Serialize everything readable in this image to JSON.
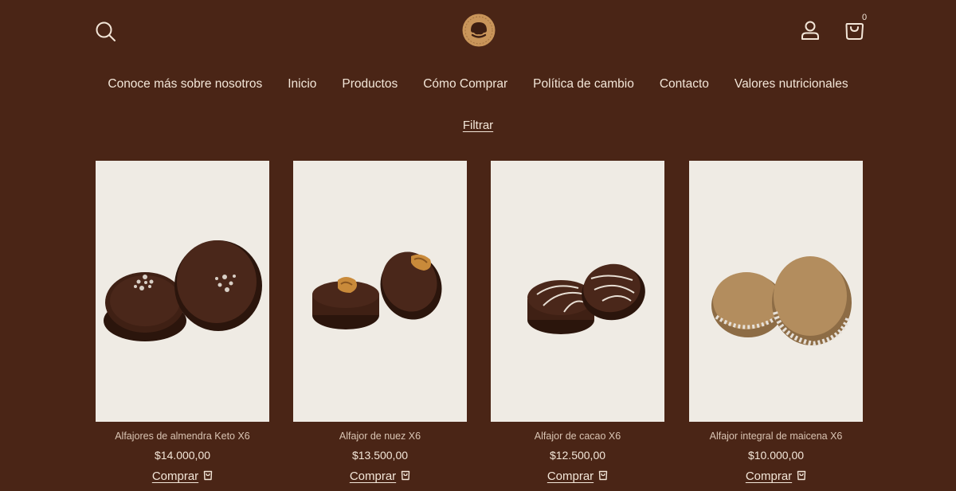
{
  "header": {
    "search_icon": "search-icon",
    "logo_icon": "logo-icon",
    "account_icon": "user-icon",
    "cart_icon": "shopping-bag-icon",
    "cart_count": "0"
  },
  "nav": {
    "items": [
      "Conoce más sobre nosotros",
      "Inicio",
      "Productos",
      "Cómo Comprar",
      "Política de cambio",
      "Contacto",
      "Valores nutricionales"
    ]
  },
  "filter_label": "Filtrar",
  "products": [
    {
      "name": "Alfajores de almendra Keto X6",
      "price": "$14.000,00",
      "buy_label": "Comprar"
    },
    {
      "name": "Alfajor de nuez X6",
      "price": "$13.500,00",
      "buy_label": "Comprar"
    },
    {
      "name": "Alfajor de cacao X6",
      "price": "$12.500,00",
      "buy_label": "Comprar"
    },
    {
      "name": "Alfajor integral de maicena X6",
      "price": "$10.000,00",
      "buy_label": "Comprar"
    }
  ],
  "colors": {
    "background": "#4a2516",
    "text": "#f3e6d8",
    "product_name": "#d9c4b3",
    "photo_background": "#efebe4",
    "logo_gold": "#c9955a"
  }
}
